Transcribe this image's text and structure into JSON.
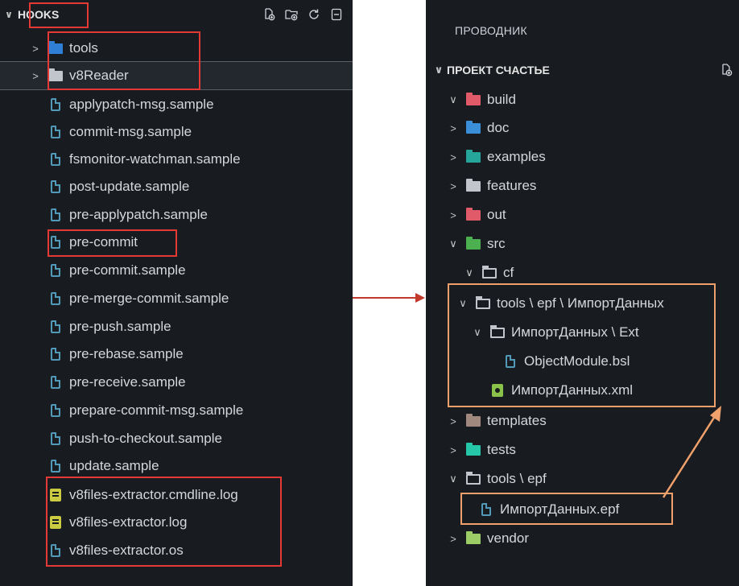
{
  "left": {
    "section_title": "HOOKS",
    "rows": [
      {
        "label": "tools",
        "kind": "folder-tools"
      },
      {
        "label": "v8Reader",
        "kind": "folder"
      },
      {
        "label": "applypatch-msg.sample",
        "kind": "file"
      },
      {
        "label": "commit-msg.sample",
        "kind": "file"
      },
      {
        "label": "fsmonitor-watchman.sample",
        "kind": "file"
      },
      {
        "label": "post-update.sample",
        "kind": "file"
      },
      {
        "label": "pre-applypatch.sample",
        "kind": "file"
      },
      {
        "label": "pre-commit",
        "kind": "file"
      },
      {
        "label": "pre-commit.sample",
        "kind": "file"
      },
      {
        "label": "pre-merge-commit.sample",
        "kind": "file"
      },
      {
        "label": "pre-push.sample",
        "kind": "file"
      },
      {
        "label": "pre-rebase.sample",
        "kind": "file"
      },
      {
        "label": "pre-receive.sample",
        "kind": "file"
      },
      {
        "label": "prepare-commit-msg.sample",
        "kind": "file"
      },
      {
        "label": "push-to-checkout.sample",
        "kind": "file"
      },
      {
        "label": "update.sample",
        "kind": "file"
      },
      {
        "label": "v8files-extractor.cmdline.log",
        "kind": "log"
      },
      {
        "label": "v8files-extractor.log",
        "kind": "log"
      },
      {
        "label": "v8files-extractor.os",
        "kind": "file"
      }
    ]
  },
  "right": {
    "panel_title": "ПРОВОДНИК",
    "section_title": "ПРОЕКТ СЧАСТЬЕ",
    "rows": [
      {
        "label": "build"
      },
      {
        "label": "doc"
      },
      {
        "label": "examples"
      },
      {
        "label": "features"
      },
      {
        "label": "out"
      },
      {
        "label": "src"
      },
      {
        "label": "cf"
      },
      {
        "label": "tools \\ epf \\ ИмпортДанных"
      },
      {
        "label": "ИмпортДанных \\ Ext"
      },
      {
        "label": "ObjectModule.bsl"
      },
      {
        "label": "ИмпортДанных.xml"
      },
      {
        "label": "templates"
      },
      {
        "label": "tests"
      },
      {
        "label": "tools \\ epf"
      },
      {
        "label": "ИмпортДанных.epf"
      },
      {
        "label": "vendor"
      }
    ]
  },
  "colors": {
    "panel_bg": "#181b20",
    "highlight_red": "#e53935",
    "highlight_orange": "#f0a06a",
    "arrow_dark_red": "#c0392b"
  }
}
